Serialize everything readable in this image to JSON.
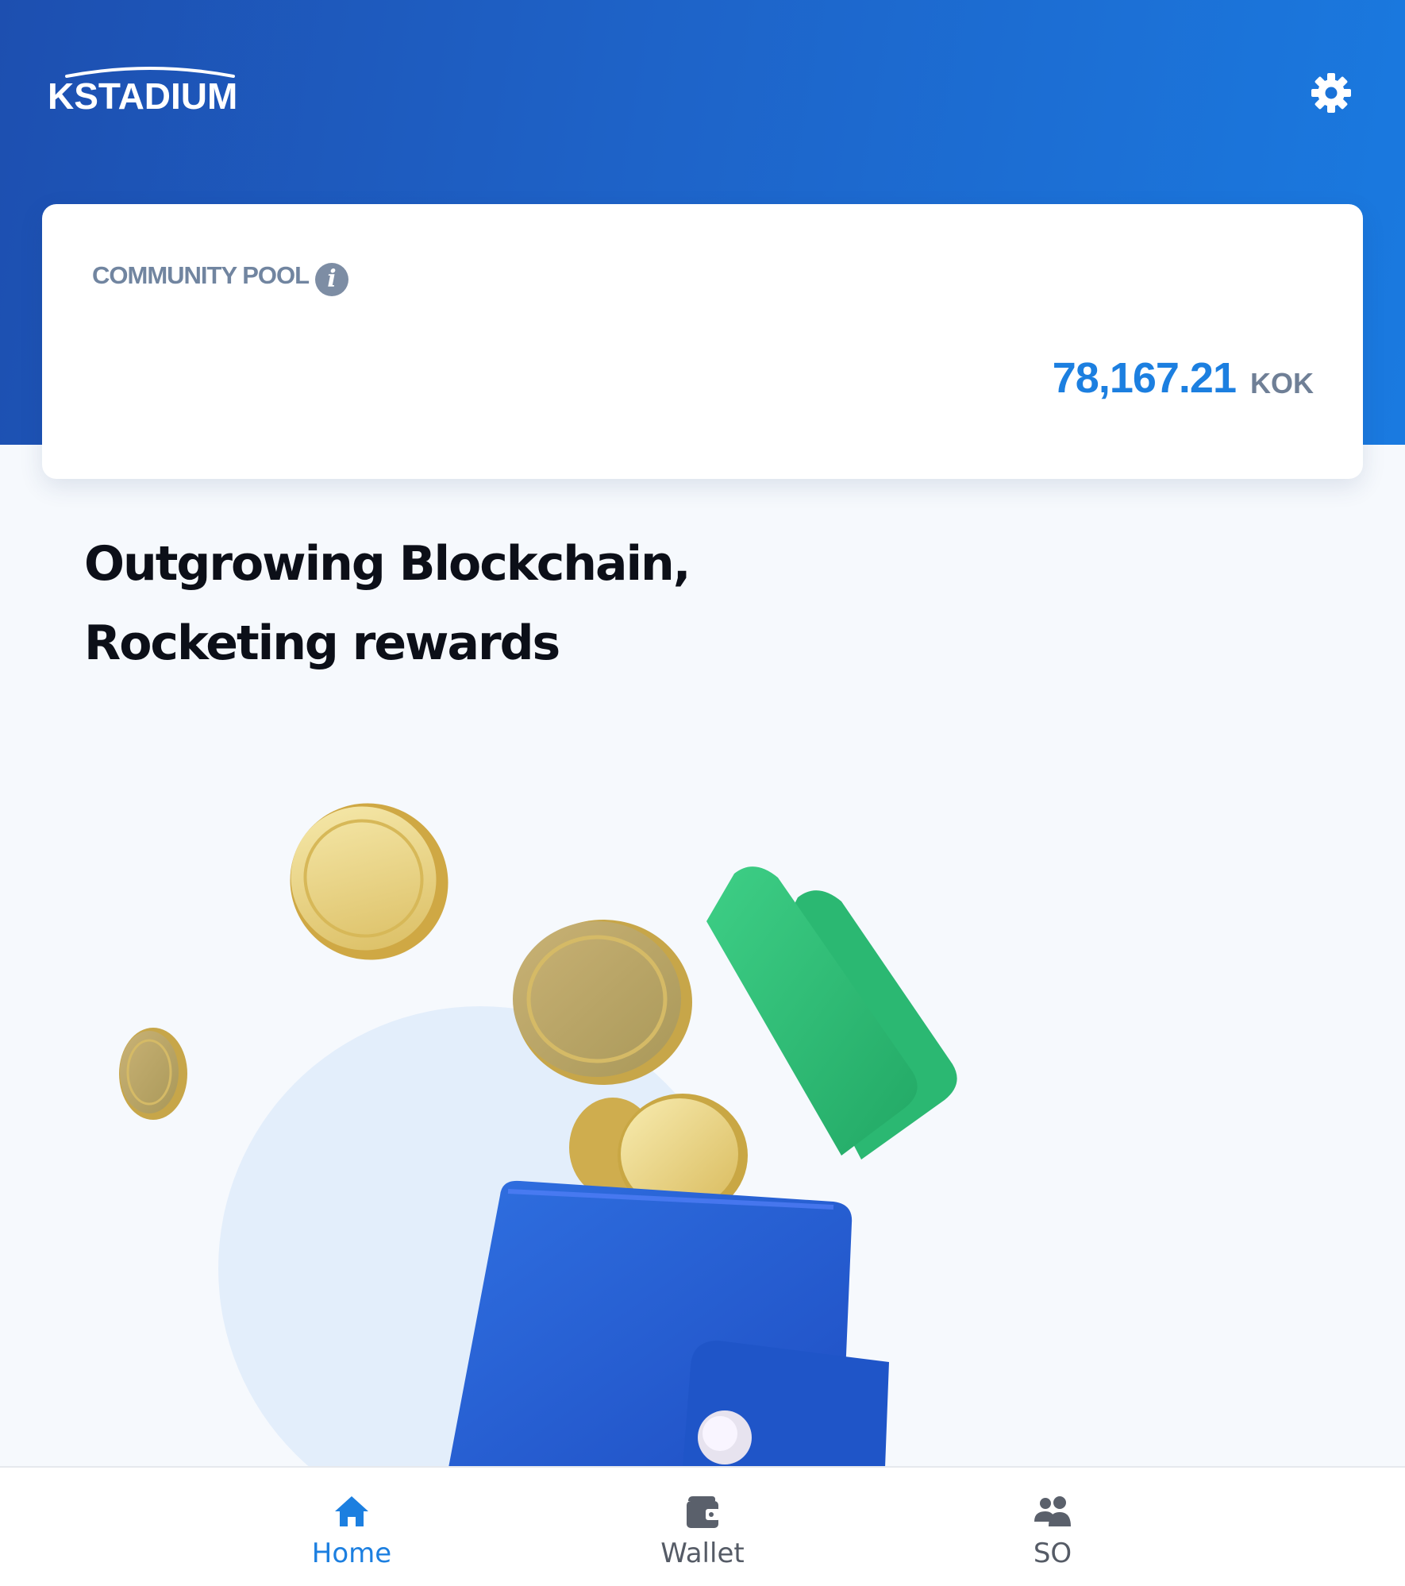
{
  "header": {
    "logo_text": "KSTADIUM",
    "settings_icon": "gear-icon"
  },
  "pool_card": {
    "label": "COMMUNITY POOL",
    "info_icon_glyph": "i",
    "value": "78,167.21",
    "unit": "KOK"
  },
  "hero": {
    "line1": "Outgrowing Blockchain,",
    "line2": "Rocketing rewards"
  },
  "colors": {
    "brand_blue": "#1d4fb0",
    "accent_blue": "#1c7fe0",
    "muted_gray": "#6f7f96",
    "coin_gold": "#d9bd62",
    "cash_green": "#2fb46e"
  },
  "tabs": [
    {
      "label": "Home",
      "icon": "home-icon",
      "active": true
    },
    {
      "label": "Wallet",
      "icon": "wallet-icon",
      "active": false
    },
    {
      "label": "SO",
      "icon": "group-icon",
      "active": false
    }
  ]
}
